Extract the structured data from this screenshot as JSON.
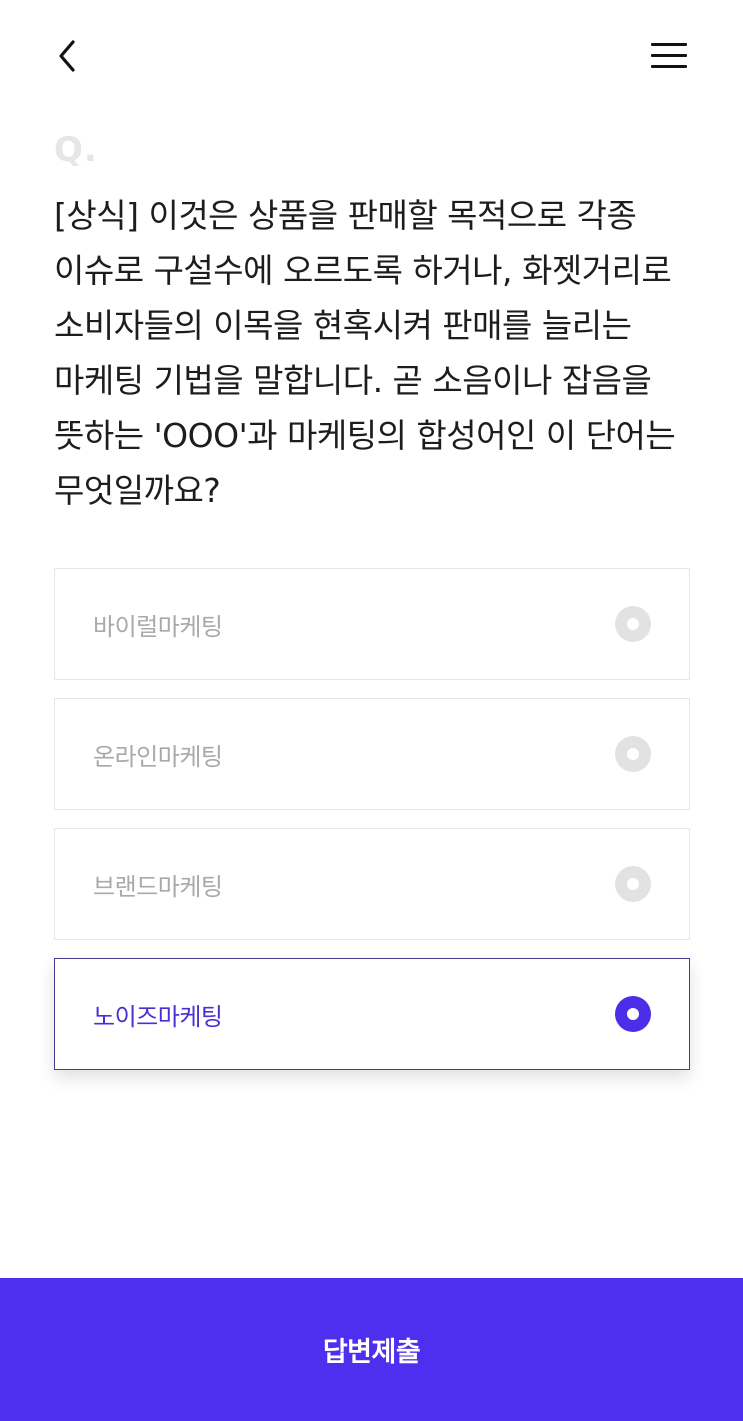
{
  "header": {
    "back_icon": "chevron-left-icon",
    "menu_icon": "hamburger-menu-icon"
  },
  "quiz": {
    "q_label": "Q.",
    "question": "[상식] 이것은 상품을 판매할 목적으로 각종 이슈로 구설수에 오르도록 하거나, 화젯거리로 소비자들의 이목을 현혹시켜 판매를 늘리는 마케팅 기법을 말합니다. 곧 소음이나 잡음을 뜻하는 'OOO'과 마케팅의 합성어인 이 단어는 무엇일까요?",
    "options": [
      {
        "label": "바이럴마케팅",
        "selected": false
      },
      {
        "label": "온라인마케팅",
        "selected": false
      },
      {
        "label": "브랜드마케팅",
        "selected": false
      },
      {
        "label": "노이즈마케팅",
        "selected": true
      }
    ]
  },
  "submit": {
    "label": "답변제출"
  },
  "colors": {
    "accent": "#4e2fef",
    "selected_text": "#4b2fd6",
    "selected_border": "#4b3a92",
    "unselected_text": "#a9a9a9",
    "radio_off": "#e2e2e2"
  }
}
